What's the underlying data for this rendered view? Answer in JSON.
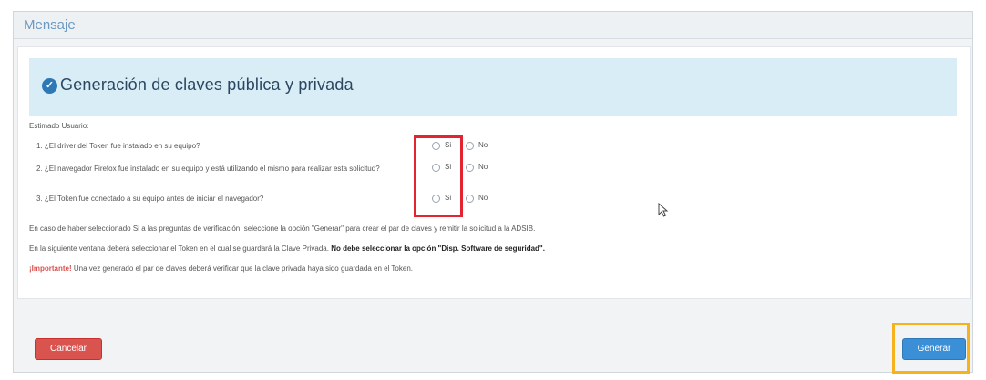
{
  "dialog": {
    "title": "Mensaje",
    "banner_title": "Generación de claves pública y privada",
    "greeting": "Estimado Usuario:",
    "questions": [
      {
        "text": "1. ¿El driver del Token fue instalado en su equipo?",
        "yes": "Si",
        "no": "No"
      },
      {
        "text": "2. ¿El navegador Firefox fue instalado en su equipo y está utilizando el mismo para realizar esta solicitud?",
        "yes": "Si",
        "no": "No"
      },
      {
        "text": "3. ¿El Token fue conectado a su equipo antes de iniciar el navegador?",
        "yes": "Si",
        "no": "No"
      }
    ],
    "info_line1": "En caso de haber seleccionado Si a las preguntas de verificación, seleccione la opción \"Generar\" para crear el par de claves y remitir la solicitud a la ADSIB.",
    "info_line2_normal": "En la siguiente ventana deberá seleccionar el Token en el cual se guardará la Clave Privada.",
    "info_line2_bold": "No debe seleccionar la opción \"Disp. Software de seguridad\".",
    "important_label": "¡Importante!",
    "important_text": "Una vez generado el par de claves deberá verificar que la clave privada haya sido guardada en el Token.",
    "cancel_label": "Cancelar",
    "generate_label": "Generar"
  },
  "colors": {
    "banner_bg": "#d9edf7",
    "cancel": "#d9534f",
    "generate": "#3a8fd6",
    "highlight_red": "#e3232f",
    "highlight_yellow": "#f5b21b"
  }
}
